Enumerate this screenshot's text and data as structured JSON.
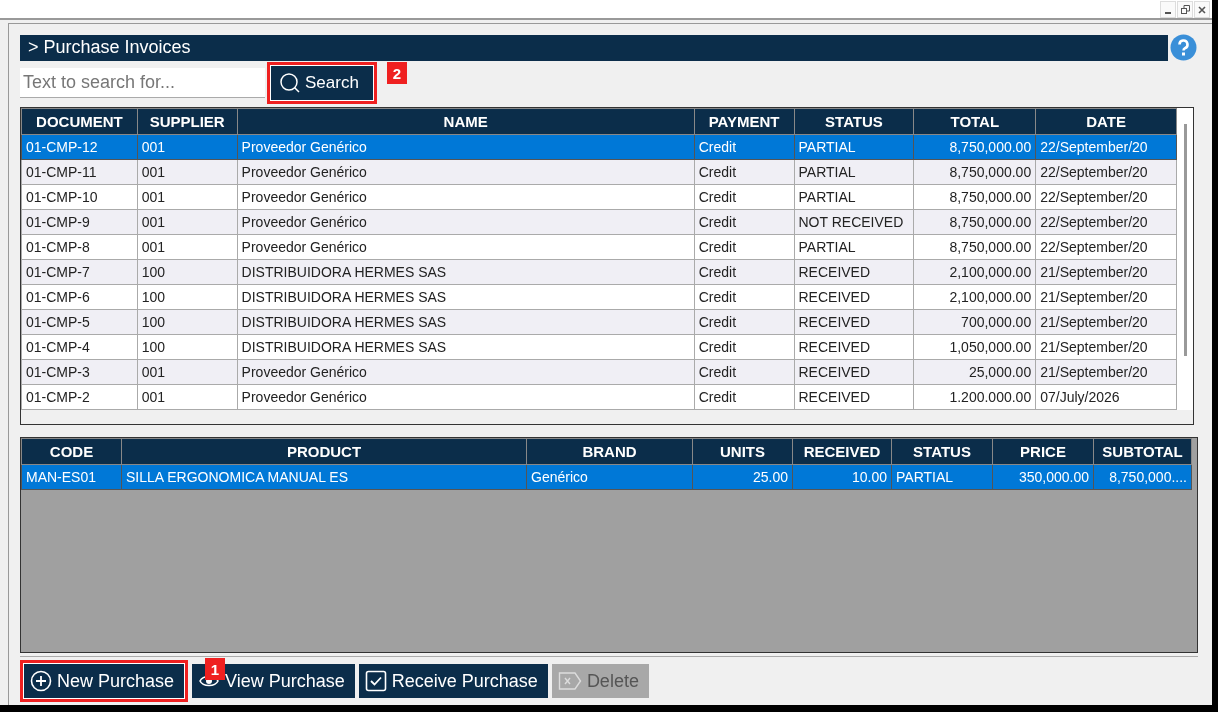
{
  "header": {
    "title": "> Purchase Invoices"
  },
  "search": {
    "placeholder": "Text to search for...",
    "button": "Search"
  },
  "invoices": {
    "columns": [
      "DOCUMENT",
      "SUPPLIER",
      "NAME",
      "PAYMENT",
      "STATUS",
      "TOTAL",
      "DATE"
    ],
    "rows": [
      {
        "selected": true,
        "cells": [
          "01-CMP-12",
          "001",
          "Proveedor Genérico",
          "Credit",
          "PARTIAL",
          "8,750,000.00",
          "22/September/20"
        ]
      },
      {
        "selected": false,
        "cells": [
          "01-CMP-11",
          "001",
          "Proveedor Genérico",
          "Credit",
          "PARTIAL",
          "8,750,000.00",
          "22/September/20"
        ]
      },
      {
        "selected": false,
        "cells": [
          "01-CMP-10",
          "001",
          "Proveedor Genérico",
          "Credit",
          "PARTIAL",
          "8,750,000.00",
          "22/September/20"
        ]
      },
      {
        "selected": false,
        "cells": [
          "01-CMP-9",
          "001",
          "Proveedor Genérico",
          "Credit",
          "NOT RECEIVED",
          "8,750,000.00",
          "22/September/20"
        ]
      },
      {
        "selected": false,
        "cells": [
          "01-CMP-8",
          "001",
          "Proveedor Genérico",
          "Credit",
          "PARTIAL",
          "8,750,000.00",
          "22/September/20"
        ]
      },
      {
        "selected": false,
        "cells": [
          "01-CMP-7",
          "100",
          "DISTRIBUIDORA HERMES SAS",
          "Credit",
          "RECEIVED",
          "2,100,000.00",
          "21/September/20"
        ]
      },
      {
        "selected": false,
        "cells": [
          "01-CMP-6",
          "100",
          "DISTRIBUIDORA HERMES SAS",
          "Credit",
          "RECEIVED",
          "2,100,000.00",
          "21/September/20"
        ]
      },
      {
        "selected": false,
        "cells": [
          "01-CMP-5",
          "100",
          "DISTRIBUIDORA HERMES SAS",
          "Credit",
          "RECEIVED",
          "700,000.00",
          "21/September/20"
        ]
      },
      {
        "selected": false,
        "cells": [
          "01-CMP-4",
          "100",
          "DISTRIBUIDORA HERMES SAS",
          "Credit",
          "RECEIVED",
          "1,050,000.00",
          "21/September/20"
        ]
      },
      {
        "selected": false,
        "cells": [
          "01-CMP-3",
          "001",
          "Proveedor Genérico",
          "Credit",
          "RECEIVED",
          "25,000.00",
          "21/September/20"
        ]
      },
      {
        "selected": false,
        "cells": [
          "01-CMP-2",
          "001",
          "Proveedor Genérico",
          "Credit",
          "RECEIVED",
          "1.200.000.00",
          "07/July/2026"
        ]
      }
    ]
  },
  "items": {
    "columns": [
      "CODE",
      "PRODUCT",
      "BRAND",
      "UNITS",
      "RECEIVED",
      "STATUS",
      "PRICE",
      "SUBTOTAL"
    ],
    "rows": [
      {
        "selected": true,
        "cells": [
          "MAN-ES01",
          "SILLA ERGONOMICA MANUAL ES",
          "Genérico",
          "25.00",
          "10.00",
          "PARTIAL",
          "350,000.00",
          "8,750,000...."
        ]
      }
    ]
  },
  "actions": [
    {
      "kind": "new",
      "label": "New Purchase",
      "disabled": false,
      "callout": "1"
    },
    {
      "kind": "view",
      "label": "View Purchase",
      "disabled": false
    },
    {
      "kind": "receive",
      "label": "Receive Purchase",
      "disabled": false
    },
    {
      "kind": "delete",
      "label": "Delete",
      "disabled": true
    }
  ],
  "search_callout": "2"
}
